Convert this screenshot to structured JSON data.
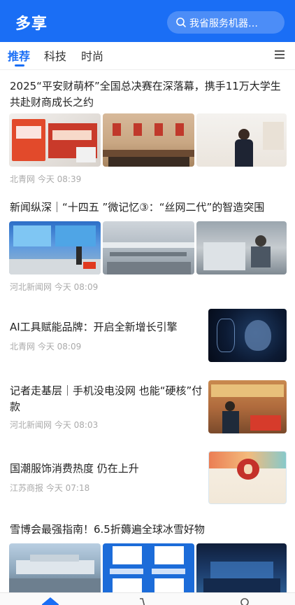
{
  "app": {
    "title": "多享"
  },
  "search": {
    "placeholder": "我省服务机器…"
  },
  "tabs": [
    {
      "label": "推荐",
      "active": true
    },
    {
      "label": "科技",
      "active": false
    },
    {
      "label": "时尚",
      "active": false
    }
  ],
  "articles": [
    {
      "title": "2025“平安财萌杯”全国总决赛在深落幕，携手11万大学生共赴财商成长之约",
      "source": "北青网",
      "time": "今天 08:39"
    },
    {
      "title": "新闻纵深｜“十四五 ”微记忆③：“丝网二代”的智造突围",
      "source": "河北新闻网",
      "time": "今天 08:09"
    },
    {
      "title": "AI工具赋能品牌：开启全新增长引擎",
      "source": "北青网",
      "time": "今天 08:09"
    },
    {
      "title": "记者走基层｜手机没电没网 也能“硬核”付款",
      "source": "河北新闻网",
      "time": "今天 08:03"
    },
    {
      "title": "国潮服饰消费热度 仍在上升",
      "source": "江苏商报",
      "time": "今天 07:18"
    },
    {
      "title": "雪博会最强指南！6.5折薅遍全球冰雪好物",
      "source": "",
      "time": ""
    }
  ],
  "icons": {
    "search": "search-icon",
    "menu": "menu-icon",
    "home": "home-icon",
    "cart": "cart-icon",
    "user": "user-icon"
  },
  "colors": {
    "brand": "#1a6ef5",
    "meta_text": "#aaaaaa"
  }
}
